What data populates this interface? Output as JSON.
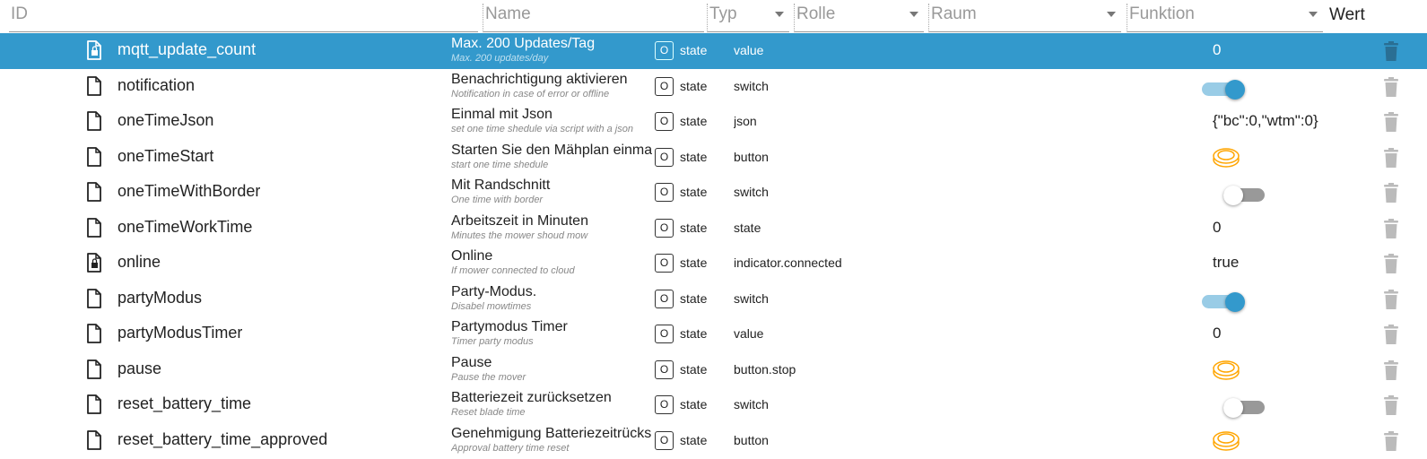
{
  "header": {
    "id": "ID",
    "name": "Name",
    "type": "Typ",
    "role": "Rolle",
    "room": "Raum",
    "function": "Funktion",
    "value": "Wert"
  },
  "colors": {
    "selected": "#3399cc",
    "toggle_on": "#3399cc",
    "toggle_on_track": "#99cce6",
    "toggle_off_track": "#999999",
    "button_icon": "#ffa500",
    "trash": "#bbbbbb"
  },
  "rows": [
    {
      "id": "mqtt_update_count",
      "icon": "file-lock-icon",
      "name": "Max. 200 Updates/Tag",
      "desc": "Max. 200 updates/day",
      "type": "state",
      "role": "value",
      "value": "0",
      "selected": true
    },
    {
      "id": "notification",
      "icon": "file-icon",
      "name": "Benachrichtigung aktivieren",
      "desc": "Notification in case of error or offline",
      "type": "state",
      "role": "switch",
      "toggle": true
    },
    {
      "id": "oneTimeJson",
      "icon": "file-icon",
      "name": "Einmal mit Json",
      "desc": "set one time shedule via script with a json",
      "type": "state",
      "role": "json",
      "value": "{\"bc\":0,\"wtm\":0}"
    },
    {
      "id": "oneTimeStart",
      "icon": "file-icon",
      "name": "Starten Sie den Mähplan einmal",
      "desc": "start one time shedule",
      "type": "state",
      "role": "button",
      "button": true
    },
    {
      "id": "oneTimeWithBorder",
      "icon": "file-icon",
      "name": "Mit Randschnitt",
      "desc": "One time with border",
      "type": "state",
      "role": "switch",
      "toggle": false
    },
    {
      "id": "oneTimeWorkTime",
      "icon": "file-icon",
      "name": "Arbeitszeit in Minuten",
      "desc": "Minutes the mower shoud mow",
      "type": "state",
      "role": "state",
      "value": "0"
    },
    {
      "id": "online",
      "icon": "file-lock-icon",
      "name": "Online",
      "desc": "If mower connected to cloud",
      "type": "state",
      "role": "indicator.connected",
      "value": "true"
    },
    {
      "id": "partyModus",
      "icon": "file-icon",
      "name": "Party-Modus.",
      "desc": "Disabel mowtimes",
      "type": "state",
      "role": "switch",
      "toggle": true
    },
    {
      "id": "partyModusTimer",
      "icon": "file-icon",
      "name": "Partymodus Timer",
      "desc": "Timer party modus",
      "type": "state",
      "role": "value",
      "value": "0"
    },
    {
      "id": "pause",
      "icon": "file-icon",
      "name": "Pause",
      "desc": "Pause the mover",
      "type": "state",
      "role": "button.stop",
      "button": true
    },
    {
      "id": "reset_battery_time",
      "icon": "file-icon",
      "name": "Batteriezeit zurücksetzen",
      "desc": "Reset blade time",
      "type": "state",
      "role": "switch",
      "toggle": false
    },
    {
      "id": "reset_battery_time_approved",
      "icon": "file-icon",
      "name": "Genehmigung Batteriezeitrücksetzung",
      "desc": "Approval battery time reset",
      "type": "state",
      "role": "button",
      "button": true
    }
  ]
}
